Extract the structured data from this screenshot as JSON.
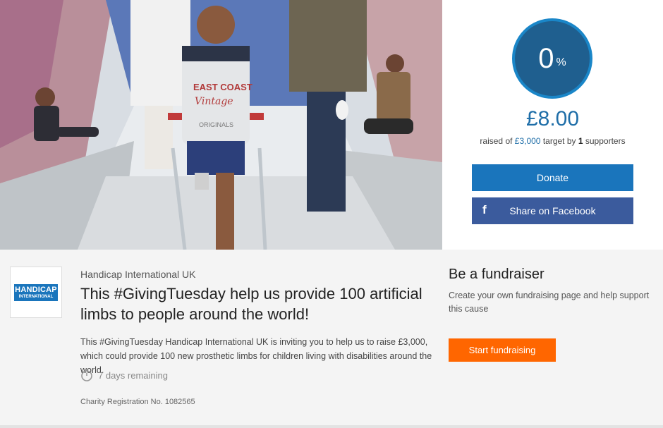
{
  "hero": {
    "image_alt": "Boy using crutches in a tent with other children",
    "shirt_text_1": "EAST COAST",
    "shirt_text_2": "Vintage",
    "shirt_text_3": "ORIGINALS"
  },
  "progress": {
    "percent": "0",
    "percent_symbol": "%",
    "percent_value": 0,
    "amount": "£8.00",
    "raised_prefix": "raised of ",
    "target": "£3,000",
    "target_mid": " target by ",
    "supporters_count": "1",
    "supporters_suffix": " supporters"
  },
  "actions": {
    "donate_label": "Donate",
    "share_label": "Share on Facebook",
    "facebook_glyph": "f"
  },
  "campaign": {
    "logo_line1": "HANDICAP",
    "logo_line2": "INTERNATIONAL",
    "org_name": "Handicap International UK",
    "title": "This #GivingTuesday help us provide 100 artificial limbs to people around the world!",
    "description": "This #GivingTuesday Handicap International UK is inviting you to help us to raise £3,000, which could provide 100 new prosthetic limbs for children living with disabilities around the world.",
    "days_remaining": "7 days remaining",
    "charity_reg": "Charity Registration No. 1082565"
  },
  "fundraiser": {
    "heading": "Be a fundraiser",
    "text": "Create your own fundraising page and help support this cause",
    "button_label": "Start fundraising"
  },
  "colors": {
    "brand_blue": "#1a75bc",
    "facebook_blue": "#3b5b9d",
    "orange": "#ff6600",
    "ring": "#1f5f8f"
  },
  "icons": {
    "timer": "stopwatch-icon",
    "facebook": "facebook-icon"
  }
}
